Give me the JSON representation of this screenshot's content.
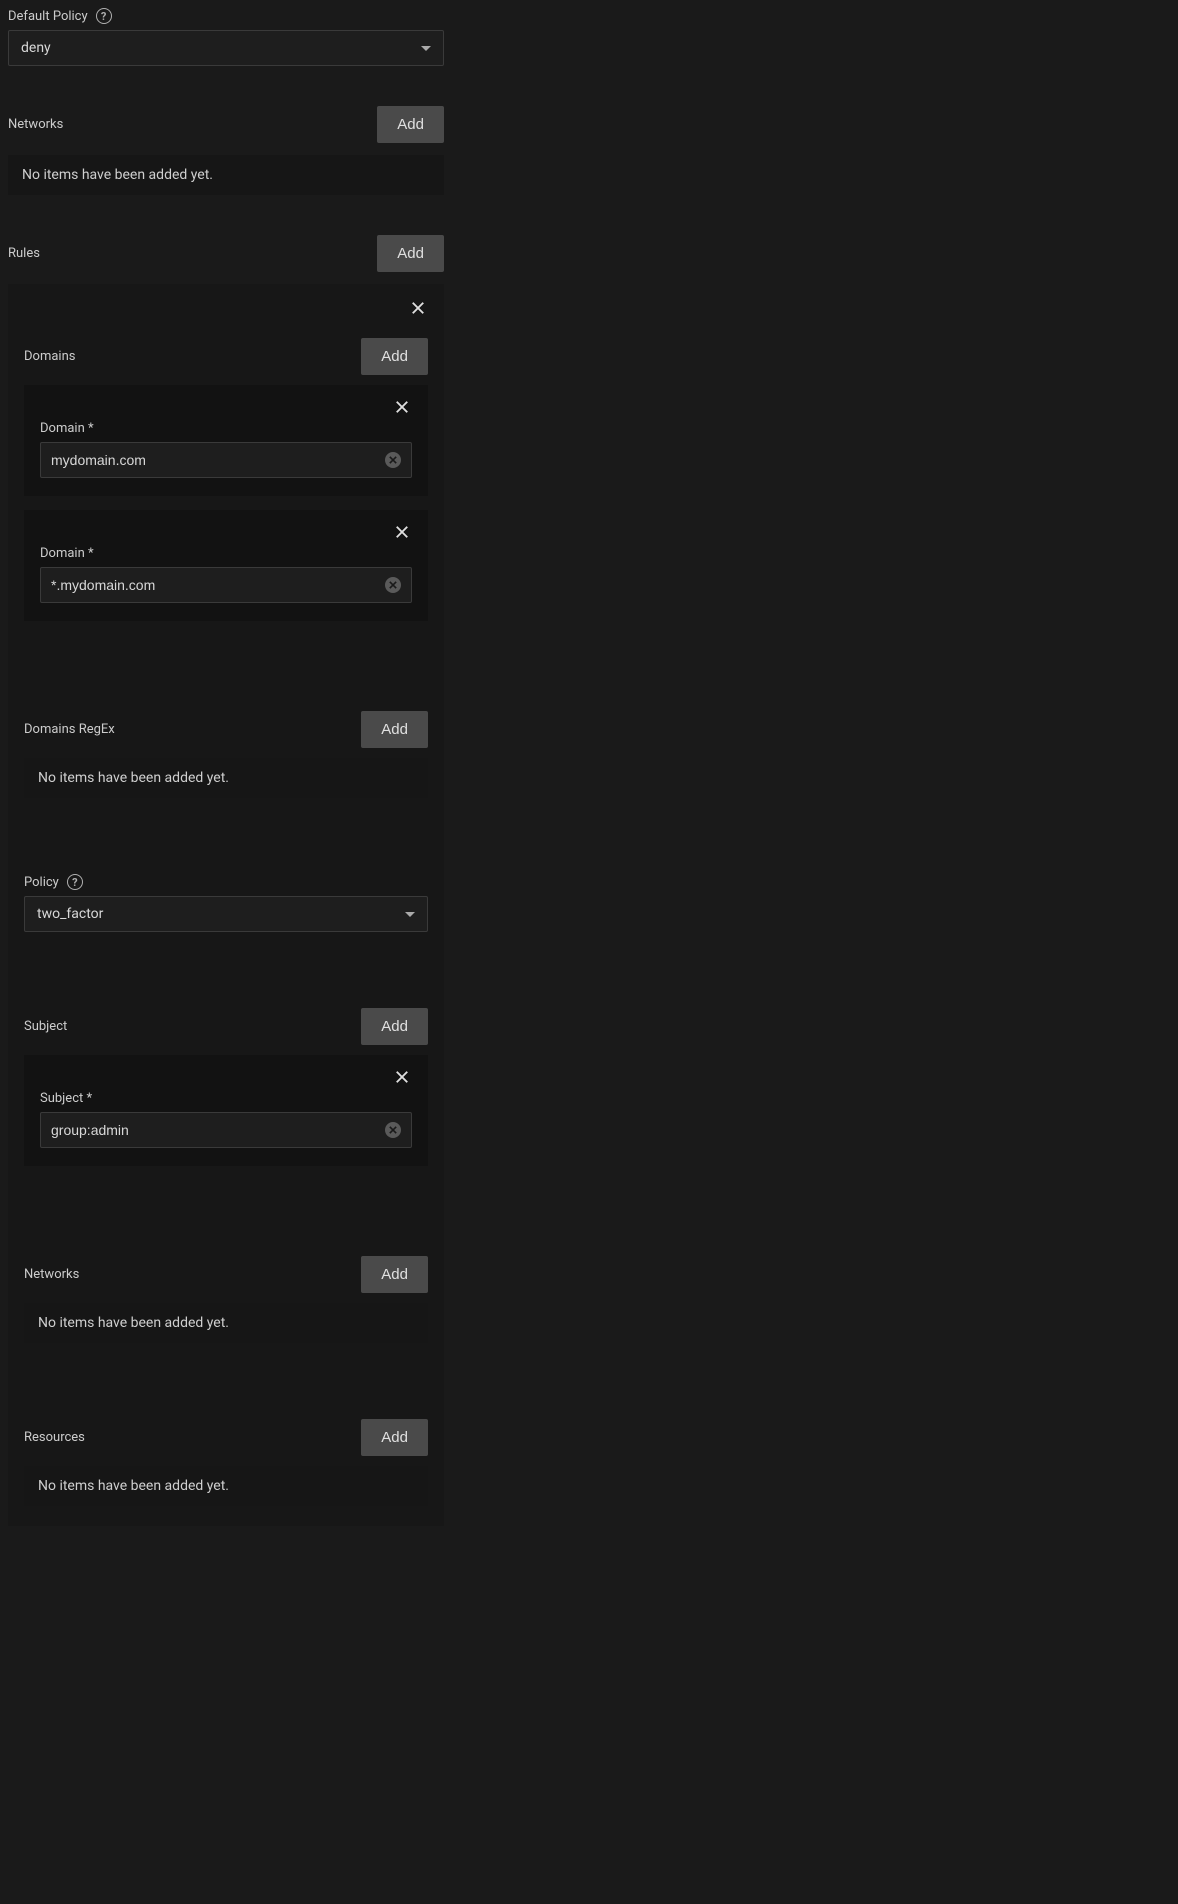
{
  "labels": {
    "default_policy": "Default Policy",
    "networks": "Networks",
    "rules": "Rules",
    "domains": "Domains",
    "domain_field": "Domain",
    "domains_regex": "Domains RegEx",
    "policy": "Policy",
    "subject": "Subject",
    "subject_field": "Subject",
    "resources": "Resources",
    "add": "Add",
    "no_items": "No items have been added yet.",
    "required_marker": "*"
  },
  "values": {
    "default_policy": "deny",
    "policy": "two_factor",
    "domains": [
      "mydomain.com",
      "*.mydomain.com"
    ],
    "subjects": [
      "group:admin"
    ]
  }
}
